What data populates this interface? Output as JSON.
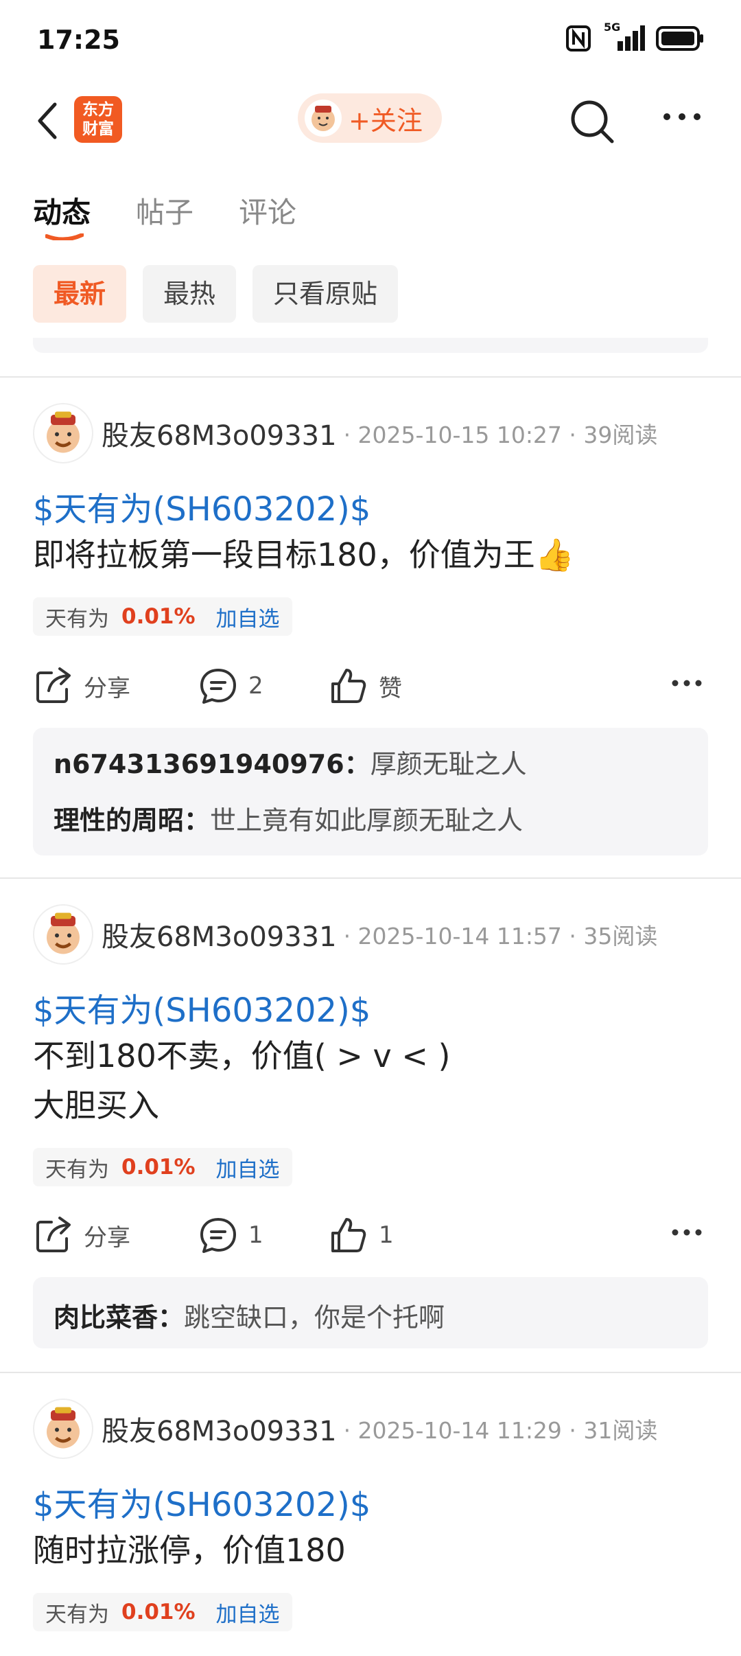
{
  "status_bar": {
    "time": "17:25",
    "network": "5G"
  },
  "nav": {
    "logo_line1": "东方",
    "logo_line2": "财富",
    "follow_label": "+关注"
  },
  "tabs": [
    {
      "label": "动态",
      "active": true
    },
    {
      "label": "帖子",
      "active": false
    },
    {
      "label": "评论",
      "active": false
    }
  ],
  "filters": [
    {
      "label": "最新",
      "active": true
    },
    {
      "label": "最热",
      "active": false
    },
    {
      "label": "只看原贴",
      "active": false
    }
  ],
  "colors": {
    "accent": "#f05a24",
    "link": "#1e6fc8",
    "up": "#e0401e"
  },
  "posts": [
    {
      "user": "股友68M3o09331",
      "meta": "· 2025-10-15 10:27 · 39阅读",
      "tag": "$天有为(SH603202)$",
      "lines": [
        "即将拉板第一段目标180，价值为王👍"
      ],
      "stock": {
        "name": "天有为",
        "change": "0.01%",
        "add": "加自选"
      },
      "actions": {
        "share": "分享",
        "comments": "2",
        "like": "赞"
      },
      "comment_list": [
        {
          "user": "n674313691940976：",
          "text": "厚颜无耻之人"
        },
        {
          "user": "理性的周昭：",
          "text": "世上竟有如此厚颜无耻之人"
        }
      ]
    },
    {
      "user": "股友68M3o09331",
      "meta": "· 2025-10-14 11:57 · 35阅读",
      "tag": "$天有为(SH603202)$",
      "lines": [
        "不到180不卖，价值( > v < )",
        "大胆买入"
      ],
      "stock": {
        "name": "天有为",
        "change": "0.01%",
        "add": "加自选"
      },
      "actions": {
        "share": "分享",
        "comments": "1",
        "like": "1"
      },
      "comment_list": [
        {
          "user": "肉比菜香：",
          "text": "跳空缺口，你是个托啊"
        }
      ]
    },
    {
      "user": "股友68M3o09331",
      "meta": "· 2025-10-14 11:29 · 31阅读",
      "tag": "$天有为(SH603202)$",
      "lines": [
        "随时拉涨停，价值180"
      ],
      "stock": {
        "name": "天有为",
        "change": "0.01%",
        "add": "加自选"
      }
    }
  ]
}
